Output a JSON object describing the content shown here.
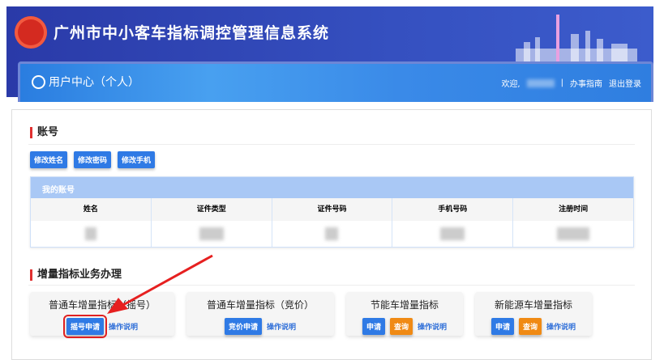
{
  "header": {
    "title": "广州市中小客车指标调控管理信息系统",
    "user_center": "用户中心（个人）",
    "welcome": "欢迎,",
    "separator": "|",
    "guide": "办事指南",
    "logout": "退出登录"
  },
  "account": {
    "section_title": "账号",
    "buttons": [
      "修改姓名",
      "修改密码",
      "修改手机"
    ],
    "table_title": "我的账号",
    "columns": [
      "姓名",
      "证件类型",
      "证件号码",
      "手机号码",
      "注册时间"
    ]
  },
  "quota": {
    "section_title": "增量指标业务办理",
    "cards": [
      {
        "name": "普通车增量指标（摇号）",
        "actions": [
          {
            "label": "摇号申请",
            "type": "primary"
          }
        ],
        "help": "操作说明"
      },
      {
        "name": "普通车增量指标（竞价）",
        "actions": [
          {
            "label": "竞价申请",
            "type": "primary"
          }
        ],
        "help": "操作说明"
      },
      {
        "name": "节能车增量指标",
        "actions": [
          {
            "label": "申请",
            "type": "primary"
          },
          {
            "label": "查询",
            "type": "orange"
          }
        ],
        "help": "操作说明"
      },
      {
        "name": "新能源车增量指标",
        "actions": [
          {
            "label": "申请",
            "type": "primary"
          },
          {
            "label": "查询",
            "type": "orange"
          }
        ],
        "help": "操作说明"
      }
    ]
  },
  "colors": {
    "primary": "#2f7ae5",
    "orange": "#f08a14",
    "header": "#2a3aa8",
    "highlight": "#e02020"
  }
}
